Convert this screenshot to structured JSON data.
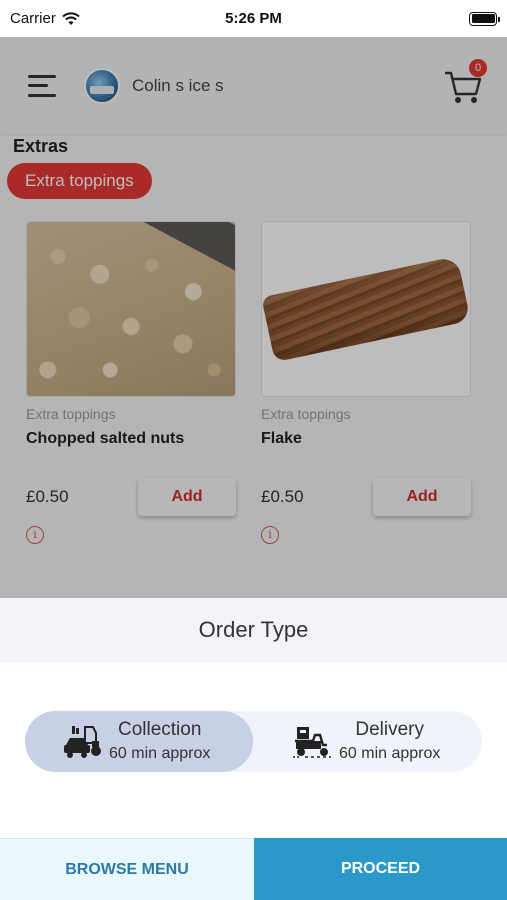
{
  "status_bar": {
    "carrier": "Carrier",
    "time": "5:26 PM"
  },
  "header": {
    "shop_name": "Colin s ice s",
    "cart_count": "0"
  },
  "section": {
    "title": "Extras",
    "category": "Extra toppings"
  },
  "products": [
    {
      "category": "Extra toppings",
      "name": "Chopped salted nuts",
      "price": "£0.50",
      "add_label": "Add"
    },
    {
      "category": "Extra toppings",
      "name": "Flake",
      "price": "£0.50",
      "add_label": "Add"
    }
  ],
  "order_sheet": {
    "title": "Order Type",
    "options": [
      {
        "label": "Collection",
        "sub": "60 min approx",
        "icon": "car-icon",
        "selected": true
      },
      {
        "label": "Delivery",
        "sub": "60 min approx",
        "icon": "delivery-scooter-icon",
        "selected": false
      }
    ]
  },
  "footer": {
    "browse_label": "BROWSE MENU",
    "proceed_label": "PROCEED"
  },
  "colors": {
    "accent_red": "#e53935",
    "proceed_blue": "#2a98c9",
    "selected_option": "#c8d0e6"
  }
}
